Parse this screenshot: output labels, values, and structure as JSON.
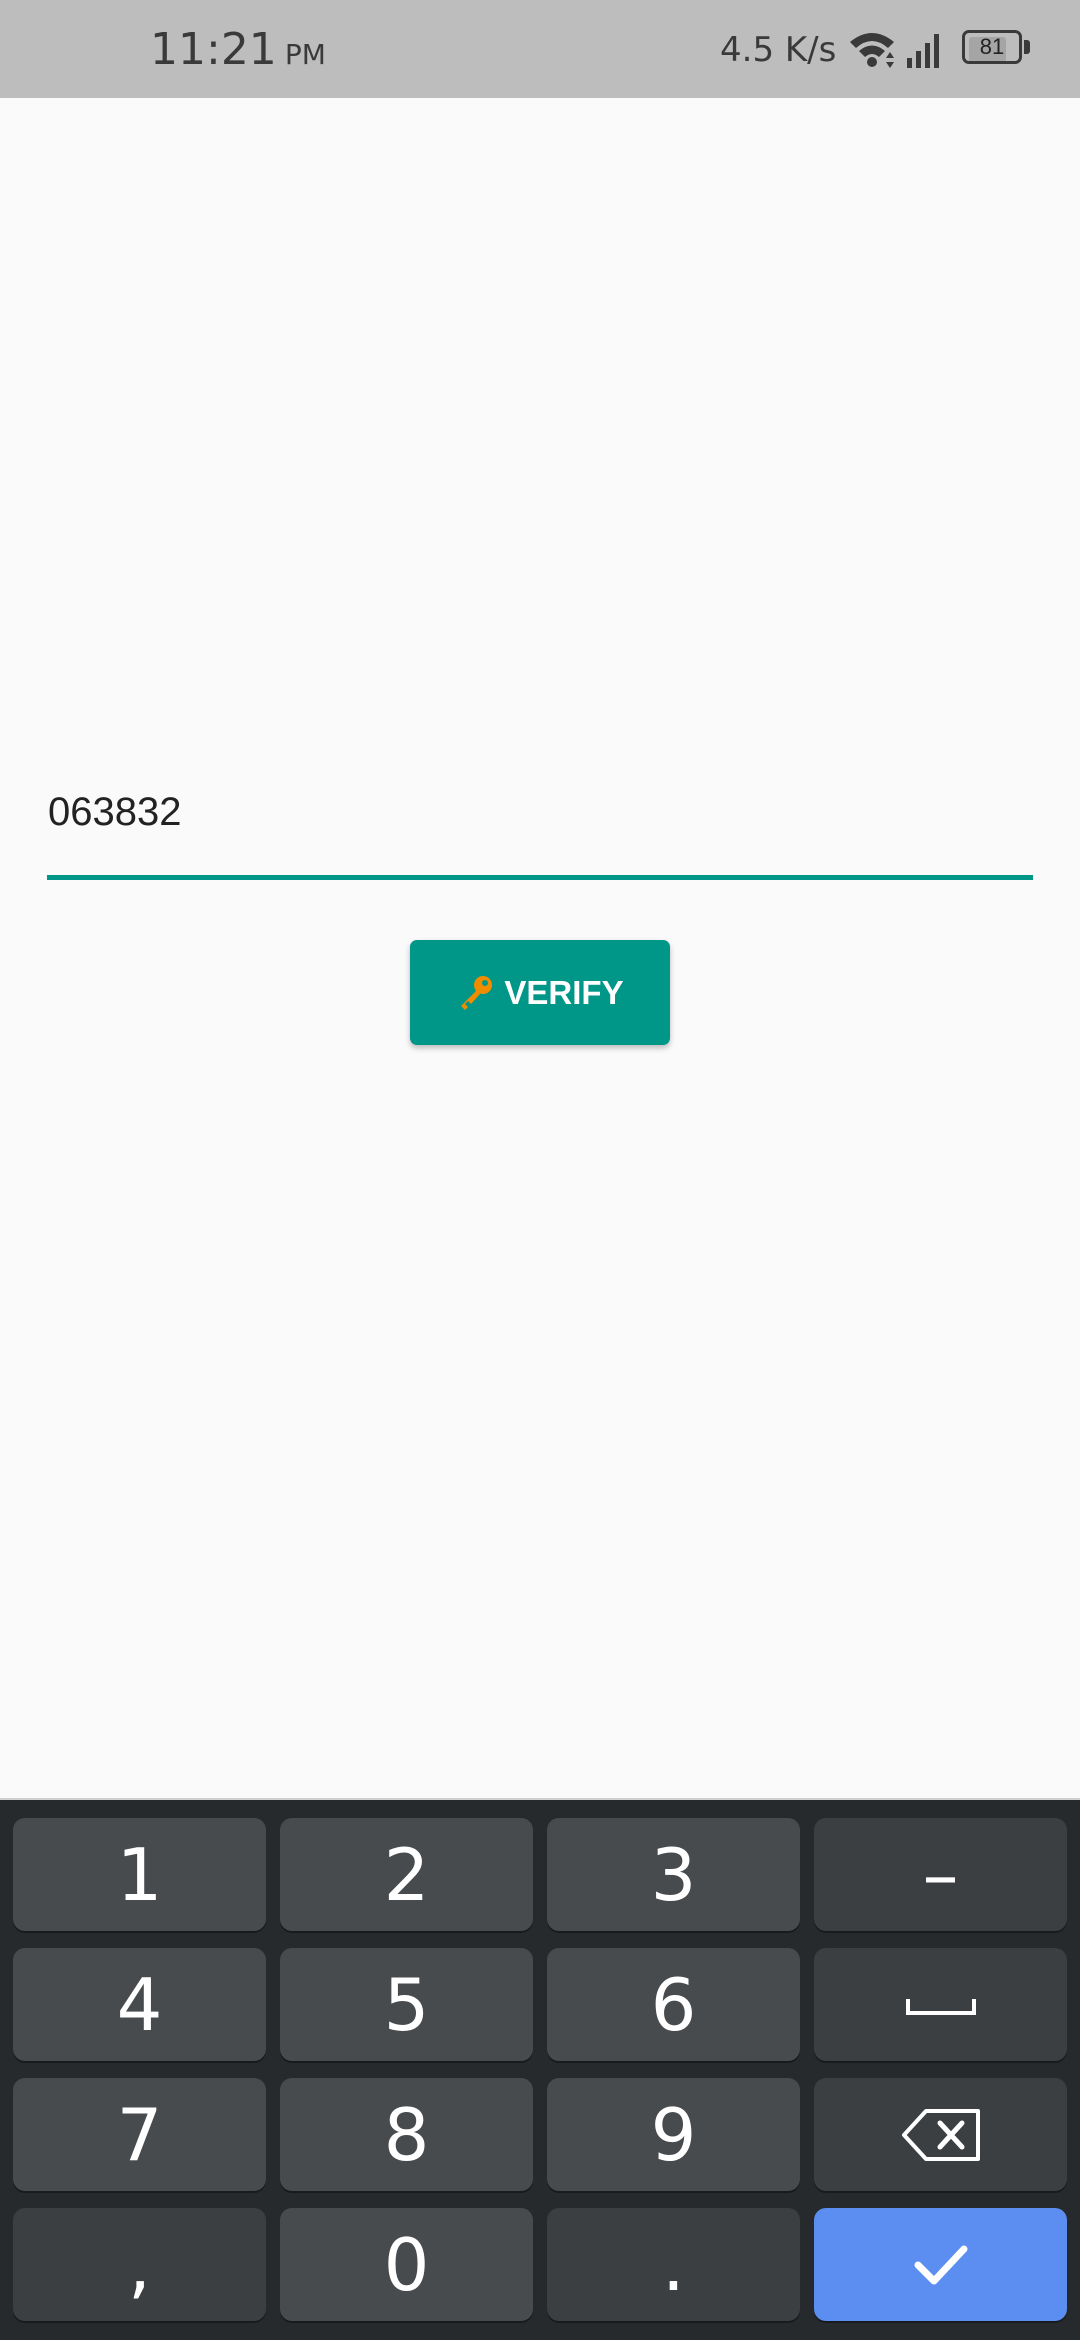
{
  "status_bar": {
    "time": "11:21",
    "ampm": "PM",
    "network_speed": "4.5 K/s",
    "battery_level": "81",
    "battery_percent": 81
  },
  "verify_form": {
    "code_value": "063832",
    "verify_label": "VERIFY",
    "accent_color": "#009688",
    "key_icon_color": "#f08c00"
  },
  "keyboard": {
    "keys": [
      "1",
      "2",
      "3",
      "–",
      "4",
      "5",
      "6",
      "",
      "7",
      "8",
      "9",
      "",
      ",",
      "0",
      ".",
      ""
    ],
    "icons": {
      "space": "space-icon",
      "backspace": "backspace-icon",
      "enter": "checkmark-icon"
    },
    "enter_color": "#5b8ef0"
  }
}
